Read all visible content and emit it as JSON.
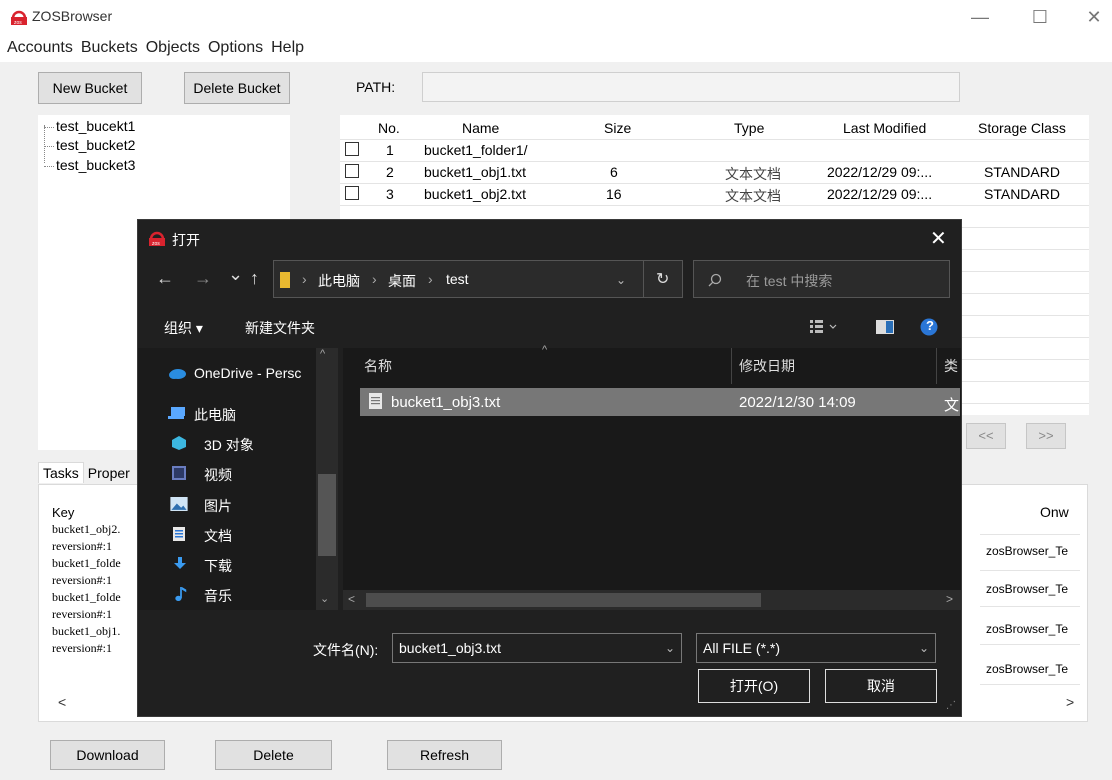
{
  "app": {
    "title": "ZOSBrowser",
    "window_controls": {
      "minimize": "—",
      "maximize": "☐",
      "close": "✕"
    }
  },
  "menu": [
    "Accounts",
    "Buckets",
    "Objects",
    "Options",
    "Help"
  ],
  "toolbar": {
    "new_bucket": "New Bucket",
    "delete_bucket": "Delete Bucket",
    "path_label": "PATH:",
    "path_value": ""
  },
  "buckets": [
    "test_bucekt1",
    "test_bucket2",
    "test_bucket3"
  ],
  "objects": {
    "headers": [
      "No.",
      "Name",
      "Size",
      "Type",
      "Last Modified",
      "Storage Class"
    ],
    "rows": [
      {
        "no": "1",
        "name": "bucket1_folder1/",
        "size": "",
        "type": "",
        "modified": "",
        "class": ""
      },
      {
        "no": "2",
        "name": "bucket1_obj1.txt",
        "size": "6",
        "type": "文本文档",
        "modified": "2022/12/29 09:...",
        "class": "STANDARD"
      },
      {
        "no": "3",
        "name": "bucket1_obj2.txt",
        "size": "16",
        "type": "文本文档",
        "modified": "2022/12/29 09:...",
        "class": "STANDARD"
      }
    ],
    "prev": "<<",
    "next": ">>"
  },
  "tabs": [
    "Tasks",
    "Proper"
  ],
  "tasks": {
    "left": [
      "Key",
      "bucket1_obj2.",
      "reversion#:1",
      "bucket1_folde",
      "reversion#:1",
      "bucket1_folde",
      "reversion#:1",
      "bucket1_obj1.",
      "reversion#:1"
    ],
    "owner_header": "Onw",
    "owners": [
      "zosBrowser_Te",
      "zosBrowser_Te",
      "zosBrowser_Te",
      "zosBrowser_Te"
    ]
  },
  "bottom_buttons": {
    "download": "Download",
    "delete": "Delete",
    "refresh": "Refresh"
  },
  "dialog": {
    "title": "打开",
    "close": "✕",
    "nav": {
      "back": "←",
      "forward": "→",
      "recent": "⌄",
      "up": "↑"
    },
    "breadcrumb": [
      "此电脑",
      "桌面",
      "test"
    ],
    "search_placeholder": "在 test 中搜索",
    "organize": "组织 ▾",
    "new_folder": "新建文件夹",
    "help": "?",
    "nav_items": [
      "OneDrive - Persc",
      "此电脑",
      "3D 对象",
      "视频",
      "图片",
      "文档",
      "下载",
      "音乐"
    ],
    "columns": [
      "名称",
      "修改日期",
      "类"
    ],
    "file": {
      "name": "bucket1_obj3.txt",
      "date": "2022/12/30 14:09",
      "type": "文"
    },
    "filename_label": "文件名(N):",
    "filename_value": "bucket1_obj3.txt",
    "filter_value": "All FILE (*.*)",
    "open_button": "打开(O)",
    "cancel_button": "取消"
  }
}
